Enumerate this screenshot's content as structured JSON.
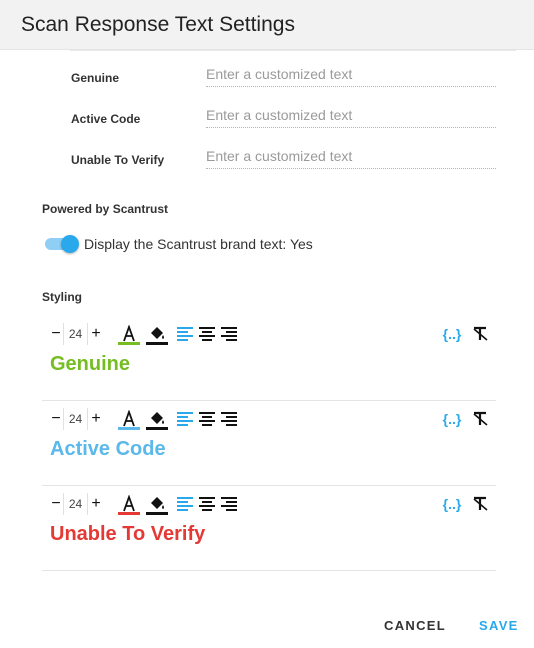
{
  "dialog": {
    "title": "Scan Response Text Settings"
  },
  "fields": [
    {
      "label": "Genuine",
      "placeholder": "Enter a customized text",
      "value": ""
    },
    {
      "label": "Active Code",
      "placeholder": "Enter a customized text",
      "value": ""
    },
    {
      "label": "Unable To Verify",
      "placeholder": "Enter a customized text",
      "value": ""
    }
  ],
  "powered": {
    "title": "Powered by Scantrust",
    "toggle_label": "Display the Scantrust brand text: Yes",
    "toggle_on": true
  },
  "styling": {
    "title": "Styling",
    "blocks": [
      {
        "size": "24",
        "preview": "Genuine",
        "color": "#76bd22",
        "variable_label": "{..}"
      },
      {
        "size": "24",
        "preview": "Active Code",
        "color": "#5bb8ea",
        "variable_label": "{..}"
      },
      {
        "size": "24",
        "preview": "Unable To Verify",
        "color": "#e53935",
        "variable_label": "{..}"
      }
    ],
    "icons": [
      "minus-icon",
      "plus-icon",
      "font-color-icon",
      "fill-color-icon",
      "align-left-icon",
      "align-center-icon",
      "align-right-icon",
      "variable-icon",
      "clear-format-icon"
    ]
  },
  "actions": {
    "cancel": "CANCEL",
    "save": "SAVE"
  },
  "colors": {
    "accent": "#29a9ec",
    "toggle_track": "#8ecff3"
  }
}
